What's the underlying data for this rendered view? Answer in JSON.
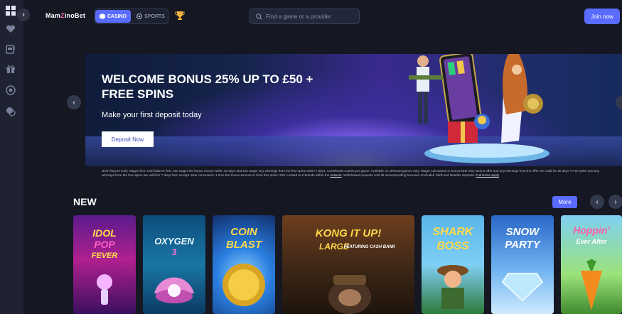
{
  "header": {
    "logo_text": "MamZinoBet",
    "logo_parts": [
      "Mam",
      "Z",
      "inoBet"
    ],
    "toggle": {
      "casino_label": "CASINO",
      "sports_label": "SPORTS",
      "active": "CASINO"
    },
    "search_placeholder": "Find a game or a provider",
    "join_label": "Join now"
  },
  "sidebar": {
    "icons": [
      "grid-icon",
      "heart-icon",
      "slot-machine-icon",
      "gift-icon",
      "chip-icon",
      "chat-icon"
    ]
  },
  "banner": {
    "title": "WELCOME BONUS 25% UP TO £50 + FREE SPINS",
    "subtitle": "Make your first deposit today",
    "cta_label": "Deposit Now",
    "terms_text": "New Players Only. Wager from real balance first. 10x wager the bonus money within 30 days and 10x wager any winnings from the free spins within 7 days. Contribution varies per game. Available on selected games only. Wager calculated on bonus bets only. Bonus offer and any winnings from the offer are valid for 30 days / Free spins and any winnings from the free spins are valid for 7 days from receipt. Max conversion: 1 time the bonus amount or from free spins: £20. Limited to 5 brands within the",
    "terms_link": "network",
    "terms_tail": ". Withdrawal requests void all active/pending bonuses. Excluded Skrill and Neteller deposits.",
    "full_terms_link": "Full terms apply"
  },
  "new_section": {
    "title": "NEW",
    "more_label": "More",
    "games": [
      {
        "name": "IDOL POP FEVER",
        "lines": [
          "IDOL",
          "POP",
          "FEVER"
        ]
      },
      {
        "name": "OXYGEN 3",
        "lines": [
          "OXYGEN",
          "3"
        ]
      },
      {
        "name": "COIN BLAST",
        "lines": [
          "COIN",
          "BLAST"
        ]
      },
      {
        "name": "KONG IT UP! LARGE",
        "lines": [
          "KONG IT UP!",
          "LARGE",
          "FEATURING CASH BANK"
        ]
      },
      {
        "name": "SHARK BOSS",
        "lines": [
          "SHARK",
          "BOSS"
        ]
      },
      {
        "name": "SNOW PARTY",
        "lines": [
          "SNOW",
          "PARTY"
        ]
      },
      {
        "name": "HOPPIN' EVER AFTER",
        "lines": [
          "Hoppin'",
          "Ever After"
        ]
      }
    ]
  },
  "colors": {
    "accent": "#5a6cff",
    "background": "#151823",
    "rail": "#1f2230"
  }
}
